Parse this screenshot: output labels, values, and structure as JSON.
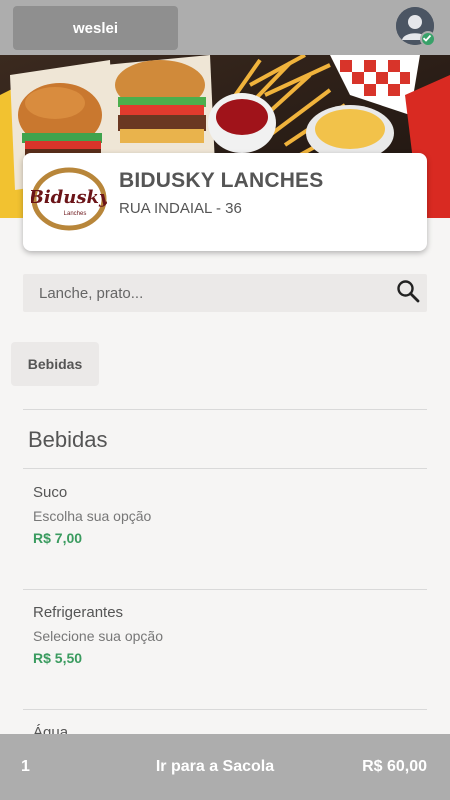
{
  "header": {
    "user_name": "weslei"
  },
  "store": {
    "logo_text": "Bidusky",
    "logo_subtext": "Lanches",
    "name": "BIDUSKY LANCHES",
    "address": "RUA INDAIAL - 36"
  },
  "search": {
    "placeholder": "Lanche, prato..."
  },
  "categories": [
    {
      "label": "Bebidas"
    }
  ],
  "section": {
    "title": "Bebidas",
    "products": [
      {
        "name": "Suco",
        "description": "Escolha sua opção",
        "price": "R$ 7,00"
      },
      {
        "name": "Refrigerantes",
        "description": "Selecione sua opção",
        "price": "R$ 5,50"
      },
      {
        "name": "Água",
        "description": "",
        "price": ""
      }
    ]
  },
  "bag": {
    "count": "1",
    "label": "Ir para a Sacola",
    "total": "R$ 60,00"
  },
  "colors": {
    "bar": "#adadad",
    "price": "#3a9b5f",
    "logo_ring": "#b8863a",
    "logo_text": "#6b1418"
  },
  "icons": [
    "avatar-icon",
    "verified-check-icon",
    "search-icon"
  ]
}
